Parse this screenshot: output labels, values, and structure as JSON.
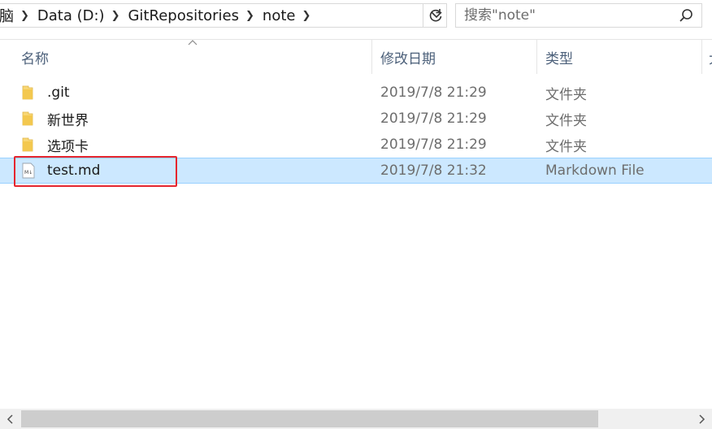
{
  "breadcrumb": {
    "items": [
      "脑",
      "Data (D:)",
      "GitRepositories",
      "note"
    ],
    "separator": "›"
  },
  "address": {
    "dropdown_icon": "chevron-down-icon",
    "refresh_icon": "refresh-icon"
  },
  "search": {
    "placeholder": "搜索\"note\"",
    "icon": "search-icon"
  },
  "columns": {
    "name": "名称",
    "date": "修改日期",
    "type": "类型",
    "extra": "大"
  },
  "files": [
    {
      "name": ".git",
      "date": "2019/7/8 21:29",
      "type": "文件夹",
      "icon": "folder-icon",
      "selected": false
    },
    {
      "name": "新世界",
      "date": "2019/7/8 21:29",
      "type": "文件夹",
      "icon": "folder-icon",
      "selected": false
    },
    {
      "name": "选项卡",
      "date": "2019/7/8 21:29",
      "type": "文件夹",
      "icon": "folder-icon",
      "selected": false
    },
    {
      "name": "test.md",
      "date": "2019/7/8 21:32",
      "type": "Markdown File",
      "icon": "markdown-file-icon",
      "selected": true
    }
  ],
  "colors": {
    "selection_bg": "#cce8ff",
    "selection_border": "#99d1ff",
    "highlight_box": "#e5262e",
    "header_text": "#4c607a",
    "folder": "#f8d775"
  }
}
